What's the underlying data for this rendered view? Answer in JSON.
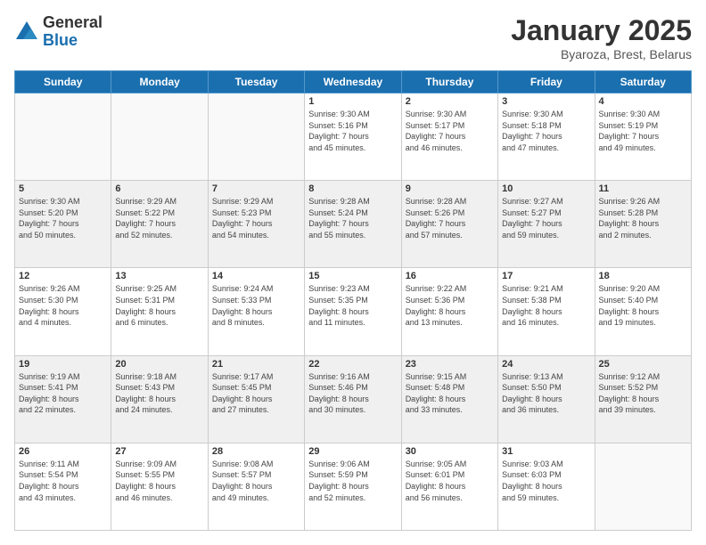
{
  "logo": {
    "general": "General",
    "blue": "Blue"
  },
  "title": "January 2025",
  "subtitle": "Byaroza, Brest, Belarus",
  "days_of_week": [
    "Sunday",
    "Monday",
    "Tuesday",
    "Wednesday",
    "Thursday",
    "Friday",
    "Saturday"
  ],
  "weeks": [
    [
      {
        "day": "",
        "info": ""
      },
      {
        "day": "",
        "info": ""
      },
      {
        "day": "",
        "info": ""
      },
      {
        "day": "1",
        "info": "Sunrise: 9:30 AM\nSunset: 5:16 PM\nDaylight: 7 hours\nand 45 minutes."
      },
      {
        "day": "2",
        "info": "Sunrise: 9:30 AM\nSunset: 5:17 PM\nDaylight: 7 hours\nand 46 minutes."
      },
      {
        "day": "3",
        "info": "Sunrise: 9:30 AM\nSunset: 5:18 PM\nDaylight: 7 hours\nand 47 minutes."
      },
      {
        "day": "4",
        "info": "Sunrise: 9:30 AM\nSunset: 5:19 PM\nDaylight: 7 hours\nand 49 minutes."
      }
    ],
    [
      {
        "day": "5",
        "info": "Sunrise: 9:30 AM\nSunset: 5:20 PM\nDaylight: 7 hours\nand 50 minutes."
      },
      {
        "day": "6",
        "info": "Sunrise: 9:29 AM\nSunset: 5:22 PM\nDaylight: 7 hours\nand 52 minutes."
      },
      {
        "day": "7",
        "info": "Sunrise: 9:29 AM\nSunset: 5:23 PM\nDaylight: 7 hours\nand 54 minutes."
      },
      {
        "day": "8",
        "info": "Sunrise: 9:28 AM\nSunset: 5:24 PM\nDaylight: 7 hours\nand 55 minutes."
      },
      {
        "day": "9",
        "info": "Sunrise: 9:28 AM\nSunset: 5:26 PM\nDaylight: 7 hours\nand 57 minutes."
      },
      {
        "day": "10",
        "info": "Sunrise: 9:27 AM\nSunset: 5:27 PM\nDaylight: 7 hours\nand 59 minutes."
      },
      {
        "day": "11",
        "info": "Sunrise: 9:26 AM\nSunset: 5:28 PM\nDaylight: 8 hours\nand 2 minutes."
      }
    ],
    [
      {
        "day": "12",
        "info": "Sunrise: 9:26 AM\nSunset: 5:30 PM\nDaylight: 8 hours\nand 4 minutes."
      },
      {
        "day": "13",
        "info": "Sunrise: 9:25 AM\nSunset: 5:31 PM\nDaylight: 8 hours\nand 6 minutes."
      },
      {
        "day": "14",
        "info": "Sunrise: 9:24 AM\nSunset: 5:33 PM\nDaylight: 8 hours\nand 8 minutes."
      },
      {
        "day": "15",
        "info": "Sunrise: 9:23 AM\nSunset: 5:35 PM\nDaylight: 8 hours\nand 11 minutes."
      },
      {
        "day": "16",
        "info": "Sunrise: 9:22 AM\nSunset: 5:36 PM\nDaylight: 8 hours\nand 13 minutes."
      },
      {
        "day": "17",
        "info": "Sunrise: 9:21 AM\nSunset: 5:38 PM\nDaylight: 8 hours\nand 16 minutes."
      },
      {
        "day": "18",
        "info": "Sunrise: 9:20 AM\nSunset: 5:40 PM\nDaylight: 8 hours\nand 19 minutes."
      }
    ],
    [
      {
        "day": "19",
        "info": "Sunrise: 9:19 AM\nSunset: 5:41 PM\nDaylight: 8 hours\nand 22 minutes."
      },
      {
        "day": "20",
        "info": "Sunrise: 9:18 AM\nSunset: 5:43 PM\nDaylight: 8 hours\nand 24 minutes."
      },
      {
        "day": "21",
        "info": "Sunrise: 9:17 AM\nSunset: 5:45 PM\nDaylight: 8 hours\nand 27 minutes."
      },
      {
        "day": "22",
        "info": "Sunrise: 9:16 AM\nSunset: 5:46 PM\nDaylight: 8 hours\nand 30 minutes."
      },
      {
        "day": "23",
        "info": "Sunrise: 9:15 AM\nSunset: 5:48 PM\nDaylight: 8 hours\nand 33 minutes."
      },
      {
        "day": "24",
        "info": "Sunrise: 9:13 AM\nSunset: 5:50 PM\nDaylight: 8 hours\nand 36 minutes."
      },
      {
        "day": "25",
        "info": "Sunrise: 9:12 AM\nSunset: 5:52 PM\nDaylight: 8 hours\nand 39 minutes."
      }
    ],
    [
      {
        "day": "26",
        "info": "Sunrise: 9:11 AM\nSunset: 5:54 PM\nDaylight: 8 hours\nand 43 minutes."
      },
      {
        "day": "27",
        "info": "Sunrise: 9:09 AM\nSunset: 5:55 PM\nDaylight: 8 hours\nand 46 minutes."
      },
      {
        "day": "28",
        "info": "Sunrise: 9:08 AM\nSunset: 5:57 PM\nDaylight: 8 hours\nand 49 minutes."
      },
      {
        "day": "29",
        "info": "Sunrise: 9:06 AM\nSunset: 5:59 PM\nDaylight: 8 hours\nand 52 minutes."
      },
      {
        "day": "30",
        "info": "Sunrise: 9:05 AM\nSunset: 6:01 PM\nDaylight: 8 hours\nand 56 minutes."
      },
      {
        "day": "31",
        "info": "Sunrise: 9:03 AM\nSunset: 6:03 PM\nDaylight: 8 hours\nand 59 minutes."
      },
      {
        "day": "",
        "info": ""
      }
    ]
  ]
}
